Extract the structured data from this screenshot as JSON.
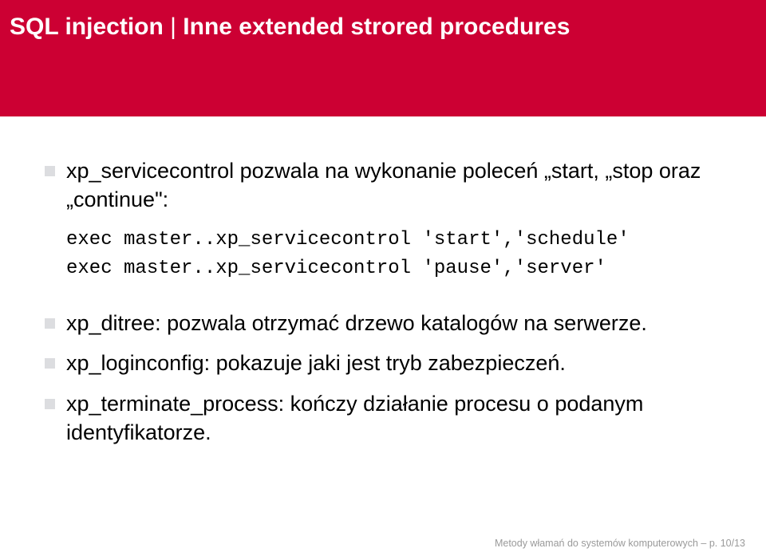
{
  "header": {
    "prefix": "SQL injection",
    "separator": " | ",
    "rest": "Inne extended strored procedures"
  },
  "bullets": [
    {
      "text": "xp_servicecontrol pozwala na wykonanie poleceń „start, „stop oraz „continue\":",
      "code": "exec master..xp_servicecontrol 'start','schedule'\nexec master..xp_servicecontrol 'pause','server'"
    },
    {
      "text": "xp_ditree: pozwala otrzymać drzewo katalogów na serwerze."
    },
    {
      "text": "xp_loginconfig: pokazuje jaki jest tryb zabezpieczeń."
    },
    {
      "text": "xp_terminate_process: kończy działanie procesu o podanym identyfikatorze."
    }
  ],
  "footer": "Metody włamań do systemów komputerowych – p. 10/13"
}
